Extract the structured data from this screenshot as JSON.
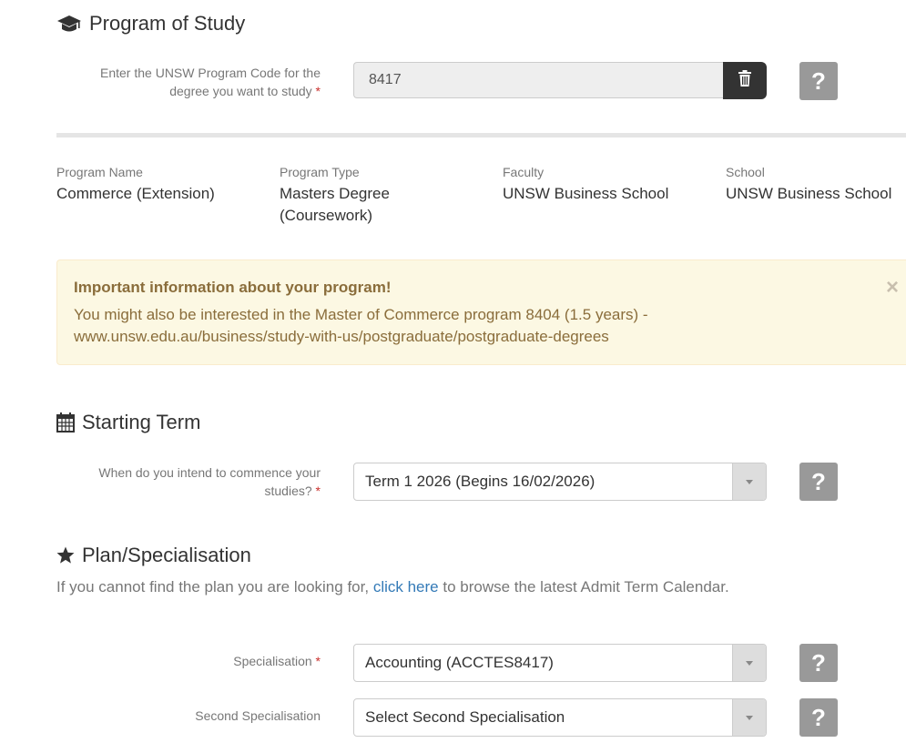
{
  "program_section": {
    "title": "Program of Study",
    "icon": "graduation-cap-icon",
    "code_label_line1": "Enter the UNSW Program Code for the",
    "code_label_line2": "degree you want to study",
    "required_mark": "*",
    "code_value": "8417",
    "help_label": "?"
  },
  "program_info": {
    "name_label": "Program Name",
    "name_value": "Commerce (Extension)",
    "type_label": "Program Type",
    "type_value_line1": "Masters Degree",
    "type_value_line2": "(Coursework)",
    "faculty_label": "Faculty",
    "faculty_value": "UNSW Business School",
    "school_label": "School",
    "school_value": "UNSW Business School"
  },
  "alert": {
    "title": "Important information about your program!",
    "body": "You might also be interested in the Master of Commerce program 8404 (1.5 years) - www.unsw.edu.au/business/study-with-us/postgraduate/postgraduate-degrees",
    "close": "×",
    "bg_color": "#fcf8e3",
    "text_color": "#8a6d3b"
  },
  "term_section": {
    "title": "Starting Term",
    "icon": "calendar-icon",
    "label_line1": "When do you intend to commence your",
    "label_line2": "studies?",
    "required_mark": "*",
    "selected": "Term 1 2026 (Begins 16/02/2026)",
    "help_label": "?"
  },
  "plan_section": {
    "title": "Plan/Specialisation",
    "icon": "star-icon",
    "note_prefix": "If you cannot find the plan you are looking for,",
    "note_link": "click here",
    "note_suffix": "to browse the latest Admit Term Calendar.",
    "link_color": "#337ab7",
    "spec_label": "Specialisation",
    "required_mark": "*",
    "spec_selected": "Accounting (ACCTES8417)",
    "second_spec_label": "Second Specialisation",
    "second_spec_selected": "Select Second Specialisation",
    "help_label": "?"
  }
}
